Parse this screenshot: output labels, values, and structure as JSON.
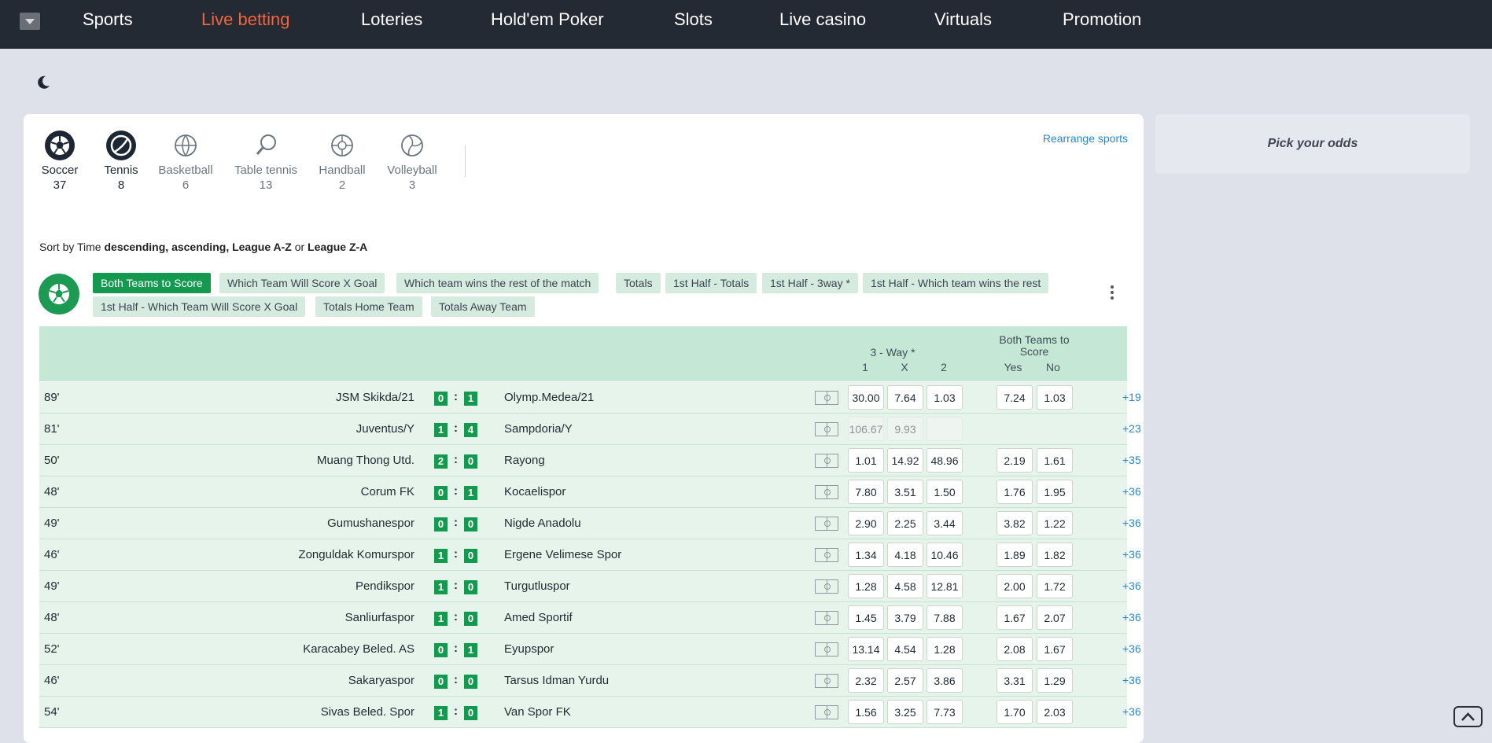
{
  "nav": {
    "items": [
      "Sports",
      "Live betting",
      "Loteries",
      "Hold'em Poker",
      "Slots",
      "Live casino",
      "Virtuals",
      "Promotion"
    ],
    "active": "Live betting"
  },
  "sports": [
    {
      "name": "Soccer",
      "count": "37",
      "icon": "soccer-ball-icon",
      "selected": true
    },
    {
      "name": "Tennis",
      "count": "8",
      "icon": "tennis-ball-icon",
      "selected": true
    },
    {
      "name": "Basketball",
      "count": "6",
      "icon": "basketball-icon",
      "selected": false
    },
    {
      "name": "Table tennis",
      "count": "13",
      "icon": "table-tennis-icon",
      "selected": false
    },
    {
      "name": "Handball",
      "count": "2",
      "icon": "handball-icon",
      "selected": false
    },
    {
      "name": "Volleyball",
      "count": "3",
      "icon": "volleyball-icon",
      "selected": false
    }
  ],
  "rearrange_label": "Rearrange sports",
  "sort": {
    "prefix": "Sort by Time",
    "opt1": "descending",
    "sep1": ",",
    "opt2": "ascending",
    "sep2": ",",
    "opt3": "League A-Z",
    "or": "or",
    "opt4": "League Z-A"
  },
  "markets": [
    {
      "label": "Both Teams to Score",
      "active": true
    },
    {
      "label": "Which Team Will Score X Goal",
      "active": false
    },
    {
      "label": "Which team wins the rest of the match",
      "active": false
    },
    {
      "label": "Totals",
      "active": false
    },
    {
      "label": "1st Half - Totals",
      "active": false
    },
    {
      "label": "1st Half - 3way *",
      "active": false
    },
    {
      "label": "1st Half - Which team wins the rest",
      "active": false
    },
    {
      "label": "1st Half - Which Team Will Score X Goal",
      "active": false
    },
    {
      "label": "Totals Home Team",
      "active": false
    },
    {
      "label": "Totals Away Team",
      "active": false
    }
  ],
  "table_header": {
    "three_way": "3 - Way *",
    "one": "1",
    "x": "X",
    "two": "2",
    "btts_line1": "Both Teams to",
    "btts_line2": "Score",
    "yes": "Yes",
    "no": "No"
  },
  "matches": [
    {
      "minute": "89'",
      "home": "JSM Skikda/21",
      "hs": "0",
      "as": "1",
      "away": "Olymp.Medea/21",
      "o1": "30.00",
      "ox": "7.64",
      "o2": "1.03",
      "yes": "7.24",
      "no": "1.03",
      "more": "+19",
      "locked": false
    },
    {
      "minute": "81'",
      "home": "Juventus/Y",
      "hs": "1",
      "as": "4",
      "away": "Sampdoria/Y",
      "o1": "106.67",
      "ox": "9.93",
      "o2": "",
      "yes": "",
      "no": "",
      "more": "+23",
      "locked": true
    },
    {
      "minute": "50'",
      "home": "Muang Thong Utd.",
      "hs": "2",
      "as": "0",
      "away": "Rayong",
      "o1": "1.01",
      "ox": "14.92",
      "o2": "48.96",
      "yes": "2.19",
      "no": "1.61",
      "more": "+35",
      "locked": false
    },
    {
      "minute": "48'",
      "home": "Corum FK",
      "hs": "0",
      "as": "1",
      "away": "Kocaelispor",
      "o1": "7.80",
      "ox": "3.51",
      "o2": "1.50",
      "yes": "1.76",
      "no": "1.95",
      "more": "+36",
      "locked": false
    },
    {
      "minute": "49'",
      "home": "Gumushanespor",
      "hs": "0",
      "as": "0",
      "away": "Nigde Anadolu",
      "o1": "2.90",
      "ox": "2.25",
      "o2": "3.44",
      "yes": "3.82",
      "no": "1.22",
      "more": "+36",
      "locked": false
    },
    {
      "minute": "46'",
      "home": "Zonguldak Komurspor",
      "hs": "1",
      "as": "0",
      "away": "Ergene Velimese Spor",
      "o1": "1.34",
      "ox": "4.18",
      "o2": "10.46",
      "yes": "1.89",
      "no": "1.82",
      "more": "+36",
      "locked": false
    },
    {
      "minute": "49'",
      "home": "Pendikspor",
      "hs": "1",
      "as": "0",
      "away": "Turgutluspor",
      "o1": "1.28",
      "ox": "4.58",
      "o2": "12.81",
      "yes": "2.00",
      "no": "1.72",
      "more": "+36",
      "locked": false
    },
    {
      "minute": "48'",
      "home": "Sanliurfaspor",
      "hs": "1",
      "as": "0",
      "away": "Amed Sportif",
      "o1": "1.45",
      "ox": "3.79",
      "o2": "7.88",
      "yes": "1.67",
      "no": "2.07",
      "more": "+36",
      "locked": false
    },
    {
      "minute": "52'",
      "home": "Karacabey Beled. AS",
      "hs": "0",
      "as": "1",
      "away": "Eyupspor",
      "o1": "13.14",
      "ox": "4.54",
      "o2": "1.28",
      "yes": "2.08",
      "no": "1.67",
      "more": "+36",
      "locked": false
    },
    {
      "minute": "46'",
      "home": "Sakaryaspor",
      "hs": "0",
      "as": "0",
      "away": "Tarsus Idman Yurdu",
      "o1": "2.32",
      "ox": "2.57",
      "o2": "3.86",
      "yes": "3.31",
      "no": "1.29",
      "more": "+36",
      "locked": false
    },
    {
      "minute": "54'",
      "home": "Sivas Beled. Spor",
      "hs": "1",
      "as": "0",
      "away": "Van Spor FK",
      "o1": "1.56",
      "ox": "3.25",
      "o2": "7.73",
      "yes": "1.70",
      "no": "2.03",
      "more": "+36",
      "locked": false
    }
  ],
  "pick_odds_label": "Pick your odds",
  "colors": {
    "topbar": "#242a33",
    "accent": "#f2643c",
    "green": "#149a50",
    "link": "#2a86c7"
  }
}
